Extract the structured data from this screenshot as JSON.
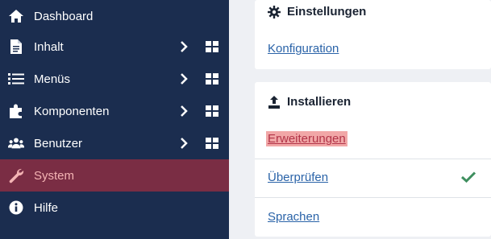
{
  "sidebar": {
    "items": [
      {
        "label": "Dashboard",
        "icon": "home-icon",
        "has_submenu": false,
        "has_dashboard_grid": false
      },
      {
        "label": "Inhalt",
        "icon": "file-icon",
        "has_submenu": true,
        "has_dashboard_grid": true
      },
      {
        "label": "Menüs",
        "icon": "list-icon",
        "has_submenu": true,
        "has_dashboard_grid": true
      },
      {
        "label": "Komponenten",
        "icon": "puzzle-icon",
        "has_submenu": true,
        "has_dashboard_grid": true
      },
      {
        "label": "Benutzer",
        "icon": "users-icon",
        "has_submenu": true,
        "has_dashboard_grid": true
      },
      {
        "label": "System",
        "icon": "wrench-icon",
        "has_submenu": false,
        "has_dashboard_grid": false,
        "active": true
      },
      {
        "label": "Hilfe",
        "icon": "info-icon",
        "has_submenu": false,
        "has_dashboard_grid": false
      }
    ]
  },
  "main": {
    "settings_card": {
      "title": "Einstellungen",
      "icon": "gear-icon",
      "links": [
        "Konfiguration"
      ]
    },
    "install_card": {
      "title": "Installieren",
      "icon": "upload-icon",
      "links": [
        "Erweiterungen",
        "Überprüfen",
        "Sprachen"
      ],
      "highlighted": "Erweiterungen",
      "checked": "Überprüfen"
    }
  },
  "colors": {
    "sidebar_bg": "#1b2d4f",
    "active_bg": "#7a2d44",
    "active_text": "#f4b4b4",
    "link": "#2a63a8",
    "highlight_bg": "#f1a7a7",
    "check": "#3f8f5f"
  }
}
